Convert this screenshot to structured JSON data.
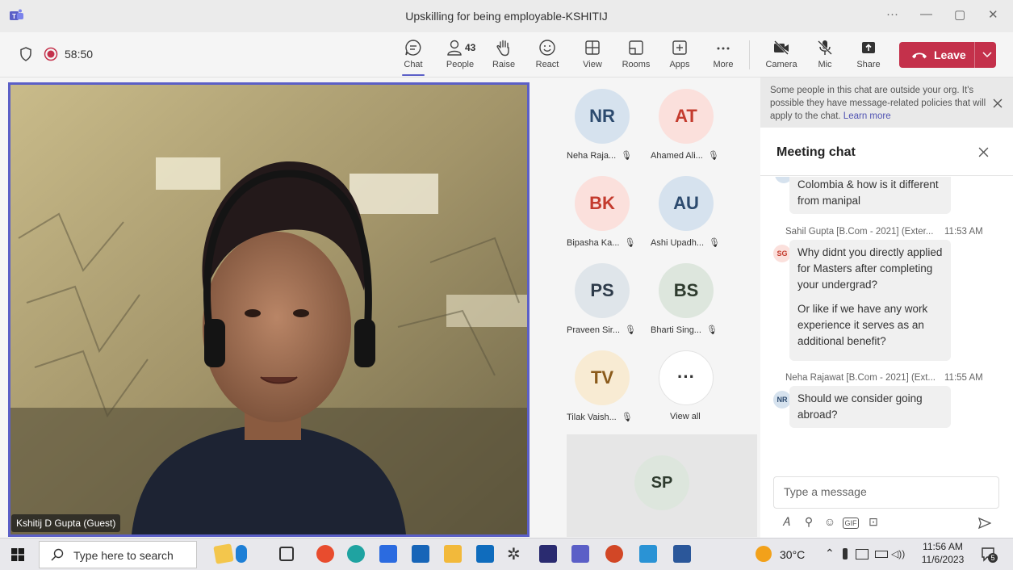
{
  "window": {
    "title": "Upskilling for being employable-KSHITIJ",
    "more_label": "···",
    "minimize_label": "—",
    "restore_label": "▢",
    "close_label": "✕"
  },
  "meeting": {
    "timer": "58:50"
  },
  "toolbar": {
    "people_count": "43",
    "buttons": [
      {
        "label": "Chat",
        "icon": "chat-icon"
      },
      {
        "label": "People",
        "icon": "people-icon"
      },
      {
        "label": "Raise",
        "icon": "hand-icon"
      },
      {
        "label": "React",
        "icon": "smile-icon"
      },
      {
        "label": "View",
        "icon": "grid-icon"
      },
      {
        "label": "Rooms",
        "icon": "rooms-icon"
      },
      {
        "label": "Apps",
        "icon": "plus-icon"
      },
      {
        "label": "More",
        "icon": "ellipsis-icon"
      },
      {
        "label": "Camera",
        "icon": "camera-off-icon"
      },
      {
        "label": "Mic",
        "icon": "mic-off-icon"
      },
      {
        "label": "Share",
        "icon": "share-icon"
      }
    ],
    "leave_label": "Leave",
    "accent": "#5b5fc7",
    "leave_color": "#c4314b"
  },
  "video": {
    "name": "Kshitij D Gupta (Guest)"
  },
  "participants": [
    {
      "initials": "NR",
      "name": "Neha Raja...",
      "bg": "#d6e2ee",
      "fg": "#2c4a6e"
    },
    {
      "initials": "AT",
      "name": "Ahamed Ali...",
      "bg": "#fbe0dc",
      "fg": "#c43b2e"
    },
    {
      "initials": "BK",
      "name": "Bipasha Ka...",
      "bg": "#fbe0dc",
      "fg": "#c43b2e"
    },
    {
      "initials": "AU",
      "name": "Ashi Upadh...",
      "bg": "#d6e2ee",
      "fg": "#2c4a6e"
    },
    {
      "initials": "PS",
      "name": "Praveen Sir...",
      "bg": "#dfe5ea",
      "fg": "#2e3b4a"
    },
    {
      "initials": "BS",
      "name": "Bharti Sing...",
      "bg": "#dde6dd",
      "fg": "#2e3b2e"
    },
    {
      "initials": "TV",
      "name": "Tilak Vaish...",
      "bg": "#f8ebd3",
      "fg": "#8a5a1a"
    },
    {
      "initials": "···",
      "name": "View all",
      "bg": "#ffffff",
      "fg": "#333333"
    }
  ],
  "sp_tile": {
    "initials": "SP"
  },
  "chat": {
    "notice_text": "Some people in this chat are outside your org. It's possible they have message-related policies that will apply to the chat.",
    "notice_link": "Learn more",
    "title": "Meeting chat",
    "messages": [
      {
        "sender": "",
        "time": "",
        "initials": "",
        "text": "Colombia & how is it different from manipal"
      },
      {
        "sender": "Sahil Gupta [B.Com - 2021] (Exter...",
        "time": "11:53 AM",
        "initials": "SG",
        "text": "Why didnt you directly applied for Masters after completing your undergrad?",
        "text2": "Or like if we have any work experience it serves as an additional benefit?"
      },
      {
        "sender": "Neha Rajawat [B.Com - 2021] (Ext...",
        "time": "11:55 AM",
        "initials": "NR",
        "text": "Should we consider going abroad?"
      }
    ],
    "input_placeholder": "Type a message"
  },
  "taskbar": {
    "search_placeholder": "Type here to search",
    "temperature": "30°C",
    "time": "11:56 AM",
    "date": "11/6/2023",
    "notification_count": "5"
  }
}
